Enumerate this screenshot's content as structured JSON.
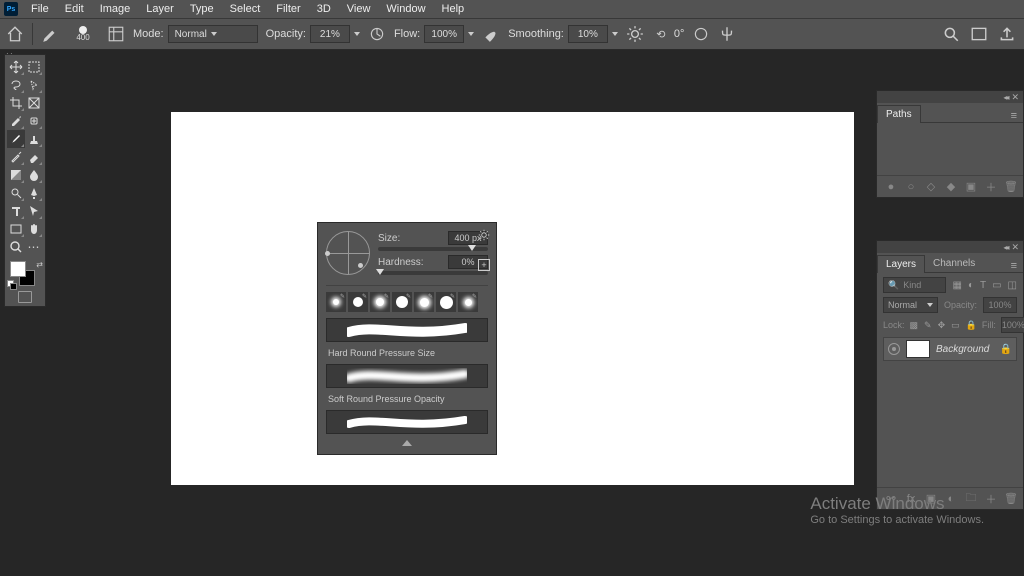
{
  "menu": {
    "items": [
      "File",
      "Edit",
      "Image",
      "Layer",
      "Type",
      "Select",
      "Filter",
      "3D",
      "View",
      "Window",
      "Help"
    ]
  },
  "options": {
    "brush_size": "400",
    "mode_label": "Mode:",
    "mode_value": "Normal",
    "opacity_label": "Opacity:",
    "opacity_value": "21%",
    "flow_label": "Flow:",
    "flow_value": "100%",
    "smoothing_label": "Smoothing:",
    "smoothing_value": "10%",
    "angle_label": "0°"
  },
  "brush_popup": {
    "size_label": "Size:",
    "size_value": "400 px",
    "hardness_label": "Hardness:",
    "hardness_value": "0%",
    "strokes": [
      "Hard Round Pressure Size",
      "Soft Round Pressure Opacity"
    ]
  },
  "paths_panel": {
    "tab": "Paths"
  },
  "layers_panel": {
    "tabs": [
      "Layers",
      "Channels"
    ],
    "kind_placeholder": "Kind",
    "blend_mode": "Normal",
    "opacity_label": "Opacity:",
    "opacity_value": "100%",
    "lock_label": "Lock:",
    "fill_label": "Fill:",
    "fill_value": "100%",
    "layer_name": "Background"
  },
  "watermark": {
    "line1": "Activate Windows",
    "line2": "Go to Settings to activate Windows."
  }
}
